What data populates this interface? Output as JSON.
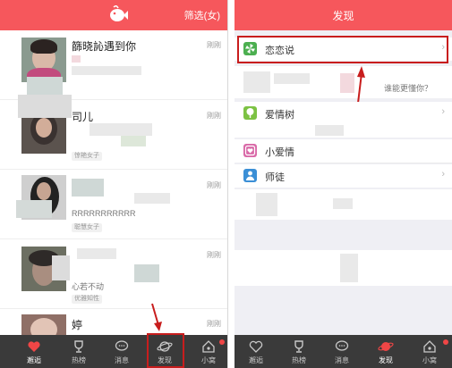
{
  "left": {
    "filter_label": "筛选(女)",
    "feed": [
      {
        "name": "篩晓訫遇到你",
        "time": "刚刚",
        "sub": "",
        "tag": ""
      },
      {
        "name": "司儿",
        "time": "刚刚",
        "sub": "",
        "tag": "惊艳女子"
      },
      {
        "name": "",
        "time": "刚刚",
        "sub": "RRRRRRRRRRR",
        "tag": "聪慧女子"
      },
      {
        "name": "",
        "time": "刚刚",
        "sub": "心若不动",
        "tag": "优雅知性"
      },
      {
        "name": "婷",
        "time": "刚刚",
        "sub": "",
        "tag": ""
      }
    ],
    "tabs": [
      {
        "label": "邂逅",
        "icon": "heart-icon",
        "active": true
      },
      {
        "label": "热榜",
        "icon": "trophy-icon",
        "active": false
      },
      {
        "label": "消息",
        "icon": "chat-bubble-icon",
        "active": false
      },
      {
        "label": "发现",
        "icon": "planet-icon",
        "active": false
      },
      {
        "label": "小窝",
        "icon": "house-icon",
        "active": false
      }
    ]
  },
  "right": {
    "title": "发现",
    "items": [
      {
        "label": "恋恋说",
        "icon": "pinwheel-icon",
        "color": "#4caf50"
      },
      {
        "label": "爱情树",
        "icon": "tree-icon",
        "color": "#7cc243"
      },
      {
        "label": "小爱情",
        "icon": "heart-box-icon",
        "color": "#d96aa8"
      },
      {
        "label": "师徒",
        "icon": "person-icon",
        "color": "#3b8fd6"
      }
    ],
    "hint": "谁能更懂你？",
    "tabs": [
      {
        "label": "邂逅",
        "icon": "heart-icon",
        "active": false
      },
      {
        "label": "热榜",
        "icon": "trophy-icon",
        "active": false
      },
      {
        "label": "消息",
        "icon": "chat-bubble-icon",
        "active": false
      },
      {
        "label": "发现",
        "icon": "planet-icon",
        "active": true
      },
      {
        "label": "小窝",
        "icon": "house-icon",
        "active": false
      }
    ]
  },
  "colors": {
    "brand": "#f6575c",
    "tabbar": "#3a3a3a",
    "annotation": "#c81d1d"
  }
}
